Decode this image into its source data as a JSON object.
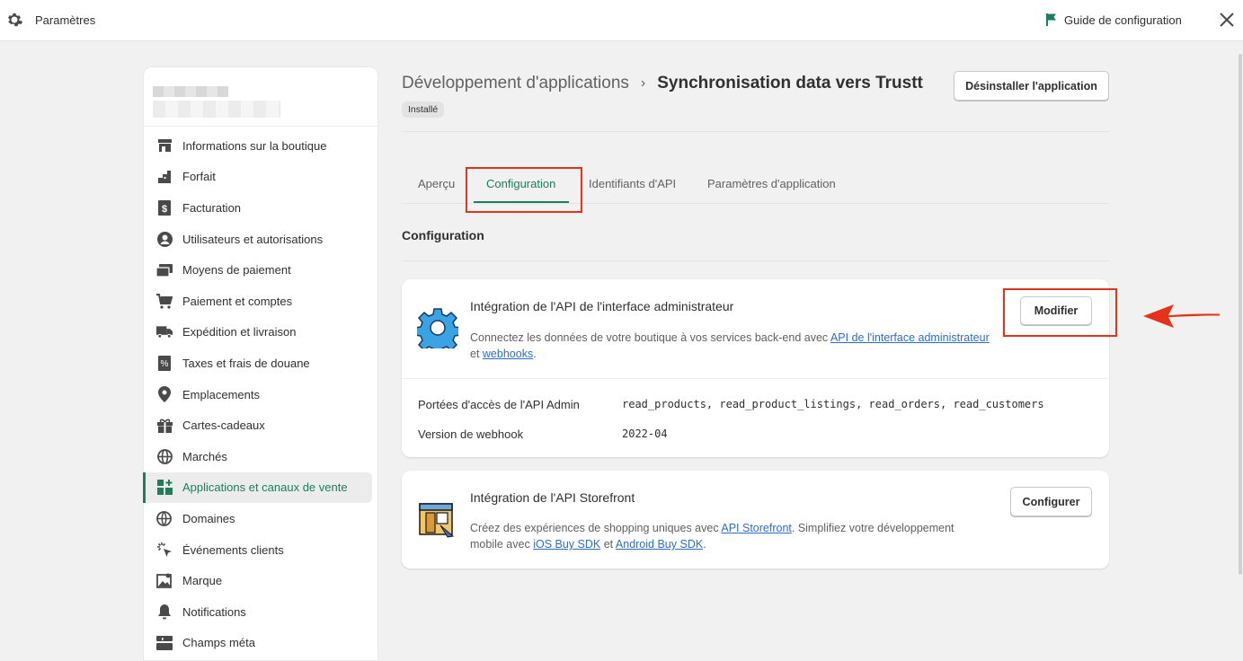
{
  "topbar": {
    "title": "Paramètres",
    "guide_label": "Guide de configuration",
    "icons": [
      "gear-icon",
      "flag-icon",
      "close-icon"
    ]
  },
  "sidebar": {
    "items": [
      {
        "label": "Informations sur la boutique",
        "icon": "store-icon"
      },
      {
        "label": "Forfait",
        "icon": "plan-icon"
      },
      {
        "label": "Facturation",
        "icon": "billing-icon"
      },
      {
        "label": "Utilisateurs et autorisations",
        "icon": "user-icon"
      },
      {
        "label": "Moyens de paiement",
        "icon": "payment-icon"
      },
      {
        "label": "Paiement et comptes",
        "icon": "cart-icon"
      },
      {
        "label": "Expédition et livraison",
        "icon": "truck-icon"
      },
      {
        "label": "Taxes et frais de douane",
        "icon": "tax-icon"
      },
      {
        "label": "Emplacements",
        "icon": "location-icon"
      },
      {
        "label": "Cartes-cadeaux",
        "icon": "gift-icon"
      },
      {
        "label": "Marchés",
        "icon": "globe-icon"
      },
      {
        "label": "Applications et canaux de vente",
        "icon": "apps-icon",
        "active": true
      },
      {
        "label": "Domaines",
        "icon": "domain-icon"
      },
      {
        "label": "Événements clients",
        "icon": "cursor-icon"
      },
      {
        "label": "Marque",
        "icon": "brand-icon"
      },
      {
        "label": "Notifications",
        "icon": "bell-icon"
      },
      {
        "label": "Champs méta",
        "icon": "metafields-icon"
      }
    ]
  },
  "header": {
    "breadcrumb_parent": "Développement d'applications",
    "breadcrumb_current": "Synchronisation data vers Trustt",
    "status_badge": "Installé",
    "uninstall_label": "Désinstaller l'application"
  },
  "tabs": [
    {
      "label": "Aperçu"
    },
    {
      "label": "Configuration",
      "active": true
    },
    {
      "label": "Identifiants d'API"
    },
    {
      "label": "Paramètres d'application"
    }
  ],
  "section_title": "Configuration",
  "admin_api_card": {
    "title": "Intégration de l'API de l'interface administrateur",
    "desc_prefix": "Connectez les données de votre boutique à vos services back-end avec ",
    "desc_link1": "API de l'interface administrateur",
    "desc_mid": "et ",
    "desc_link2": "webhooks",
    "desc_suffix": ".",
    "button_label": "Modifier",
    "scopes_label": "Portées d'accès de l'API Admin",
    "scopes_value": "read_products, read_product_listings, read_orders, read_customers",
    "webhook_label": "Version de webhook",
    "webhook_value": "2022-04"
  },
  "storefront_card": {
    "title": "Intégration de l'API Storefront",
    "desc_prefix": "Créez des expériences de shopping uniques avec ",
    "desc_link1": "API Storefront",
    "desc_mid": ". Simplifiez votre développement",
    "desc_line2_prefix": "mobile avec ",
    "desc_link2": "iOS Buy SDK",
    "desc_and": " et ",
    "desc_link3": "Android Buy SDK",
    "desc_suffix": ".",
    "button_label": "Configurer"
  },
  "colors": {
    "accent": "#1a7f5a",
    "link": "#2c6ecb",
    "annotation": "#e5331a"
  }
}
